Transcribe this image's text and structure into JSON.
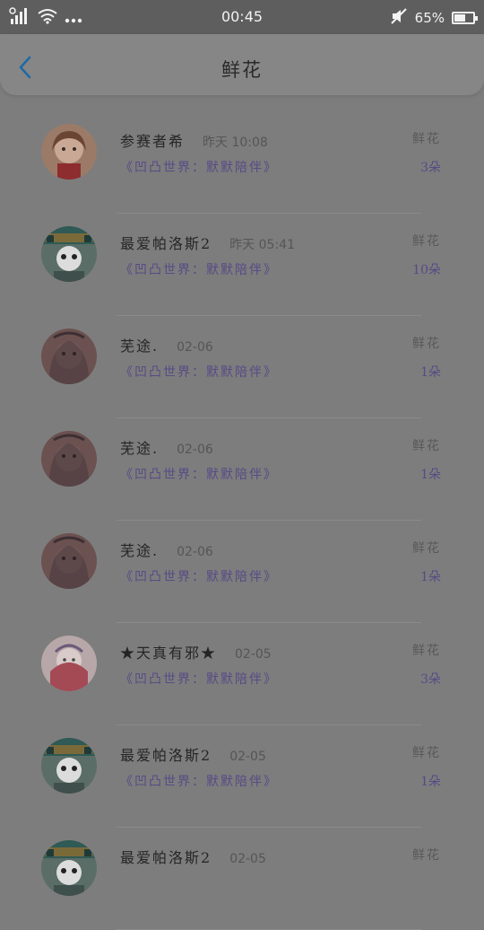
{
  "status_bar": {
    "time": "00:45",
    "battery_text": "65%",
    "battery_level": 0.65,
    "icons": [
      "signal-icon",
      "wifi-icon",
      "more-dots-icon",
      "mute-icon",
      "battery-icon"
    ]
  },
  "header": {
    "title": "鲜花",
    "back_icon": "chevron-left-icon"
  },
  "colors": {
    "accent_blue": "#1e6aa4",
    "source_purple": "#574a86"
  },
  "records": [
    {
      "name": "参赛者希",
      "time": "昨天 10:08",
      "source": "《凹凸世界：默默陪伴》",
      "gift": "鲜花",
      "count": "3朵",
      "avatar": "avatar-girl"
    },
    {
      "name": "最爱帕洛斯2",
      "time": "昨天 05:41",
      "source": "《凹凸世界：默默陪伴》",
      "gift": "鲜花",
      "count": "10朵",
      "avatar": "avatar-happy"
    },
    {
      "name": "芜途.",
      "time": "02-06",
      "source": "《凹凸世界：默默陪伴》",
      "gift": "鲜花",
      "count": "1朵",
      "avatar": "avatar-brown"
    },
    {
      "name": "芜途.",
      "time": "02-06",
      "source": "《凹凸世界：默默陪伴》",
      "gift": "鲜花",
      "count": "1朵",
      "avatar": "avatar-brown"
    },
    {
      "name": "芜途.",
      "time": "02-06",
      "source": "《凹凸世界：默默陪伴》",
      "gift": "鲜花",
      "count": "1朵",
      "avatar": "avatar-brown"
    },
    {
      "name": "★天真有邪★",
      "time": "02-05",
      "source": "《凹凸世界：默默陪伴》",
      "gift": "鲜花",
      "count": "3朵",
      "avatar": "avatar-pink"
    },
    {
      "name": "最爱帕洛斯2",
      "time": "02-05",
      "source": "《凹凸世界：默默陪伴》",
      "gift": "鲜花",
      "count": "1朵",
      "avatar": "avatar-happy"
    },
    {
      "name": "最爱帕洛斯2",
      "time": "02-05",
      "source": "",
      "gift": "鲜花",
      "count": "",
      "avatar": "avatar-happy"
    }
  ]
}
